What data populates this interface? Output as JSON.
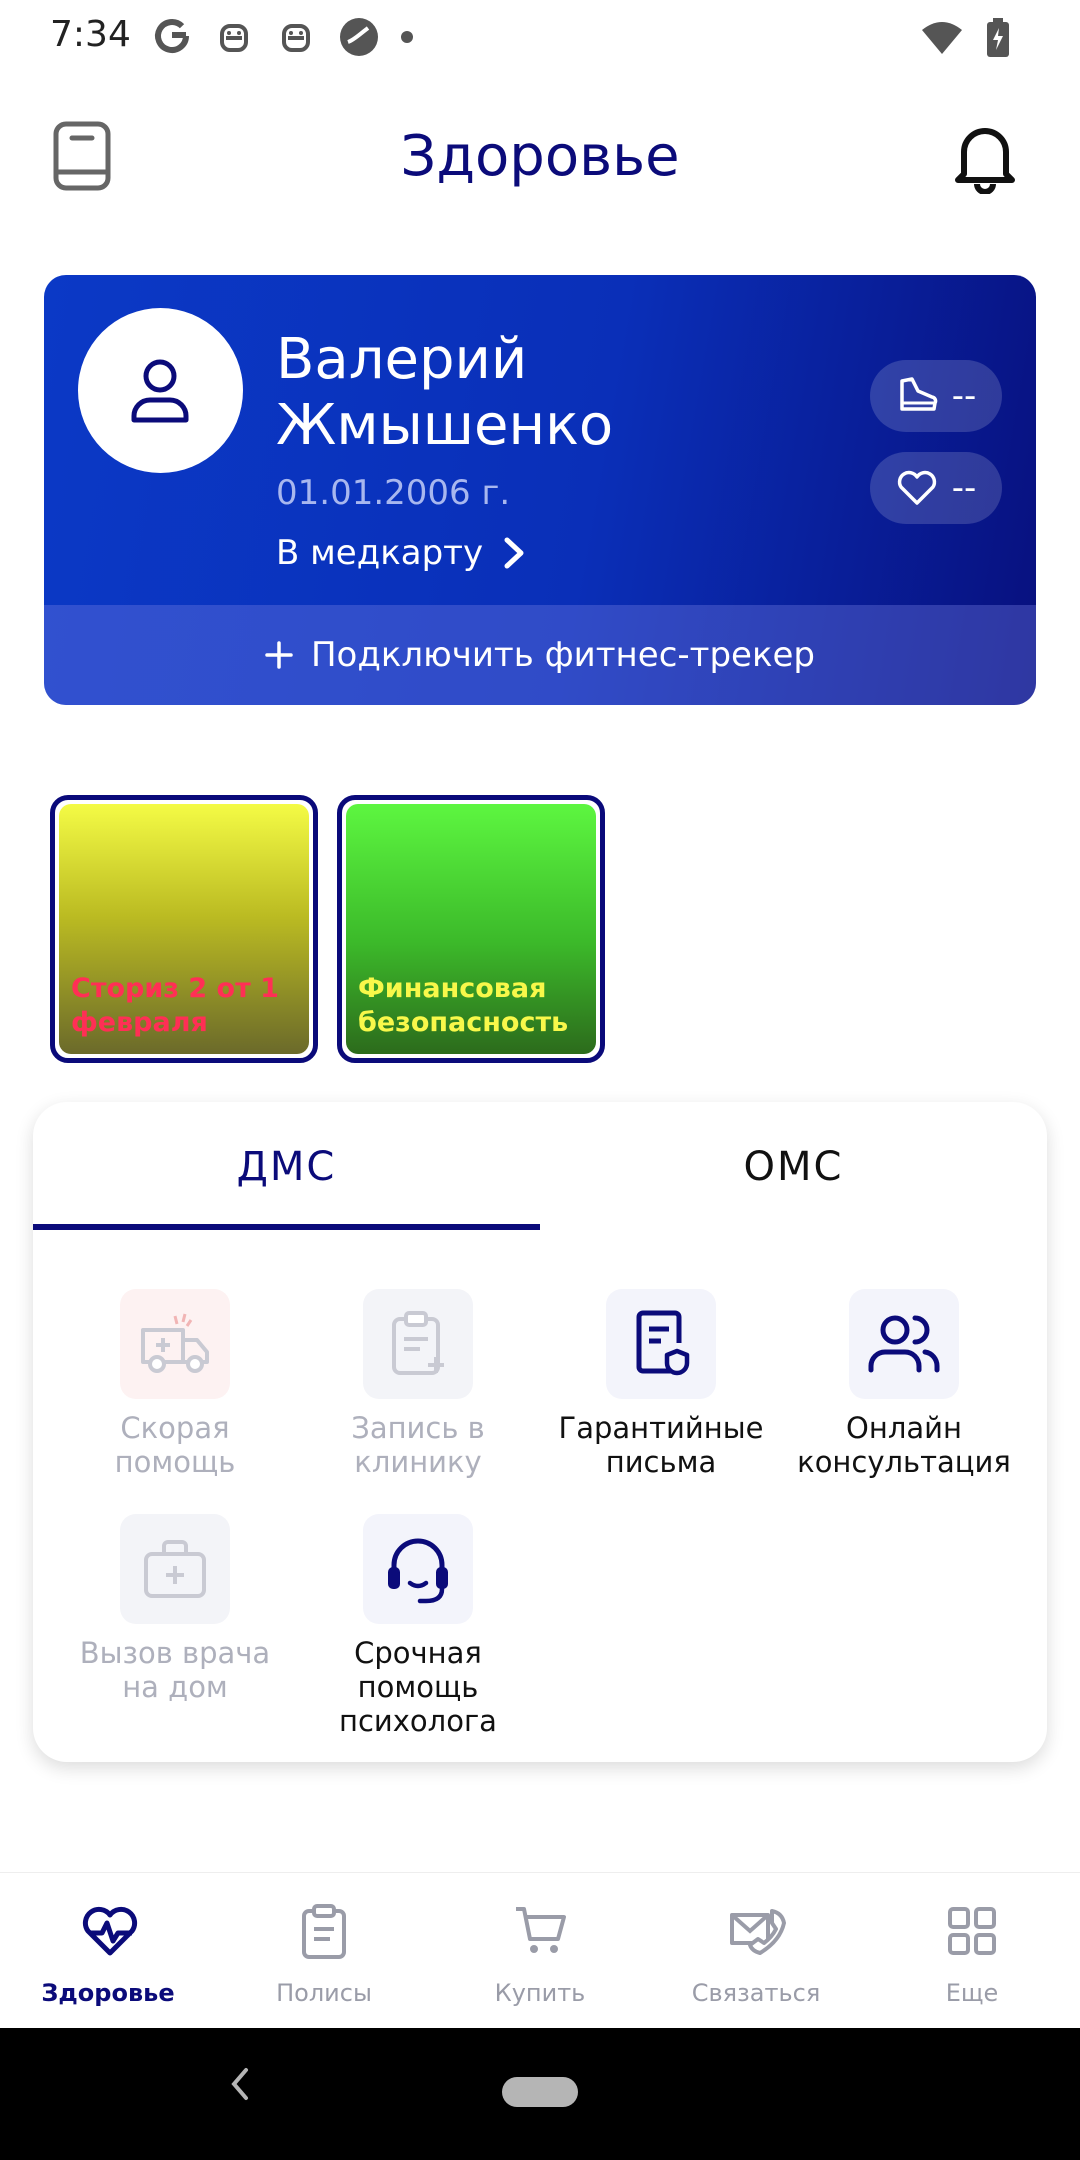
{
  "status_bar": {
    "time": "7:34"
  },
  "header": {
    "title": "Здоровье"
  },
  "profile": {
    "name": "Валерий Жмышенко",
    "dob": "01.01.2006 г.",
    "medcard_link": "В медкарту",
    "steps_value": "--",
    "heart_value": "--",
    "fitness_tracker": "Подключить фитнес-трекер"
  },
  "stories": [
    {
      "title": "Сториз 2 от 1 февраля"
    },
    {
      "title": "Финансовая безопасность"
    }
  ],
  "tabs": {
    "dms": "ДМС",
    "oms": "ОМС"
  },
  "services": {
    "ambulance": "Скорая помощь",
    "clinic": "Запись в клинику",
    "letters": "Гарантийные письма",
    "online": "Онлайн консультация",
    "doctor_home": "Вызов врача на дом",
    "psychologist": "Срочная помощь психолога"
  },
  "bottom_nav": {
    "health": "Здоровье",
    "policies": "Полисы",
    "buy": "Купить",
    "contact": "Связаться",
    "more": "Еще"
  },
  "colors": {
    "primary": "#0b0b7a",
    "card_start": "#0b39c6",
    "card_end": "#08107e"
  }
}
